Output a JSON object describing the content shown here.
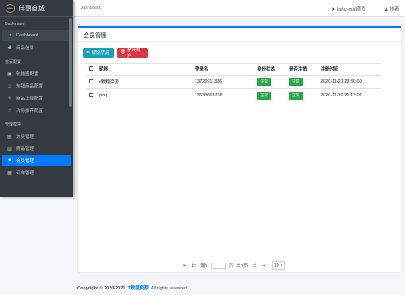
{
  "brand": {
    "logo_text": "gsee",
    "title": "佳惠商城"
  },
  "sidebar": {
    "sections": [
      {
        "header": "Dashboard",
        "items": [
          {
            "label": "Dashboard",
            "icon": "dashboard-icon"
          },
          {
            "label": "商品信息",
            "icon": "plus-icon"
          }
        ]
      },
      {
        "header": "首页配置",
        "items": [
          {
            "label": "轮播图配置",
            "icon": "image-icon"
          },
          {
            "label": "热销商品配置",
            "icon": "flame-icon"
          },
          {
            "label": "新品上线配置",
            "icon": "sparkle-icon"
          },
          {
            "label": "为你推荐配置",
            "icon": "thumb-icon"
          }
        ]
      },
      {
        "header": "管理模块",
        "items": [
          {
            "label": "分类管理",
            "icon": "bookmark-icon"
          },
          {
            "label": "商品管理",
            "icon": "list-icon"
          },
          {
            "label": "会员管理",
            "icon": "users-icon"
          },
          {
            "label": "订单管理",
            "icon": "order-icon"
          }
        ]
      }
    ]
  },
  "topbar": {
    "breadcrumb": "Dashboard",
    "home_link": "jiahui-mall首页",
    "author_link": "作者"
  },
  "card": {
    "title": "会员管理",
    "btn_enable": "解除禁用",
    "btn_disable": "禁用账户"
  },
  "table": {
    "headers": [
      "昵称",
      "登录名",
      "身份状态",
      "是否注销",
      "注册时间"
    ],
    "rows": [
      {
        "nickname": "it教程资源",
        "login": "13726911336",
        "status": "正常",
        "cancelled": "正常",
        "time": "2020-11-21 23:30:00"
      },
      {
        "nickname": "ping",
        "login": "13633663758",
        "status": "正常",
        "cancelled": "正常",
        "time": "2020-11-19 21:13:07"
      }
    ]
  },
  "pager": {
    "page_prefix": "第1",
    "page_suffix": "页",
    "total": "共1页",
    "page_size": "10"
  },
  "footer": {
    "prefix": "Copyright © 2020-2021 ",
    "link": "IT教程资源",
    "suffix": ". All rights reserved."
  },
  "colors": {
    "primary": "#007bff",
    "info": "#17a2b8",
    "danger": "#dc3545",
    "success": "#28a745",
    "sidebar": "#343a40"
  }
}
